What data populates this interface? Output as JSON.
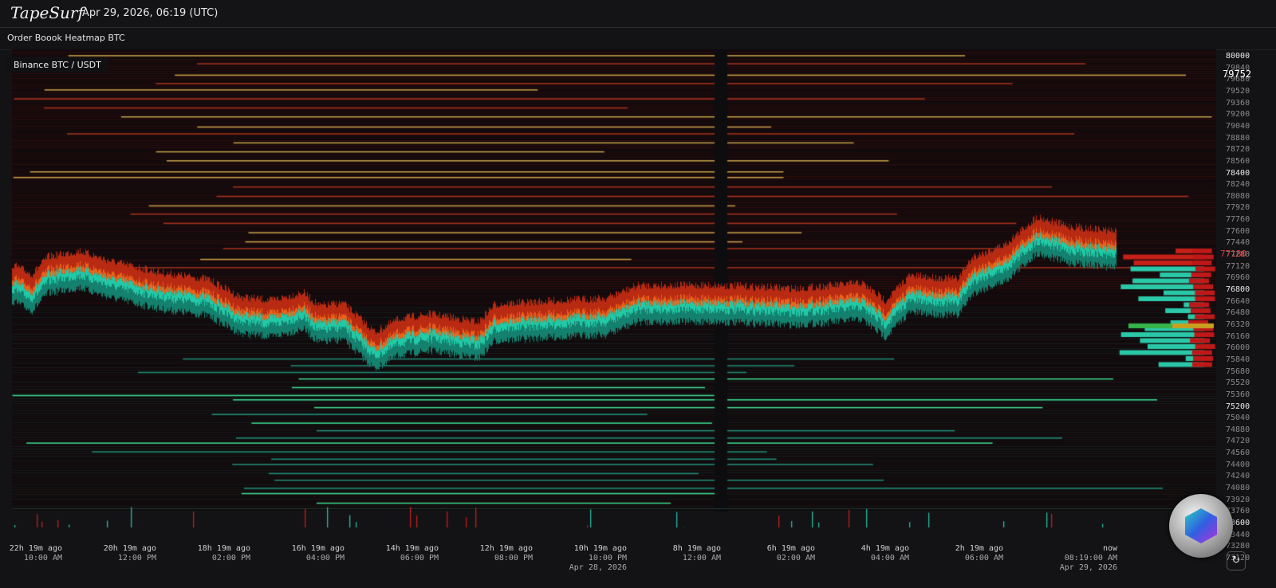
{
  "header": {
    "logo": "TapeSurf",
    "datetime": "Apr 29, 2026, 06:19 (UTC)"
  },
  "panel": {
    "title": "Order Boook Heatmap BTC",
    "pair": "Binance BTC / USDT"
  },
  "price_axis": {
    "labels": [
      "80000",
      "79840",
      "79680",
      "79520",
      "79360",
      "79200",
      "79040",
      "78880",
      "78720",
      "78560",
      "78400",
      "78240",
      "78080",
      "77920",
      "77760",
      "77600",
      "77440",
      "77280",
      "77120",
      "76960",
      "76800",
      "76640",
      "76480",
      "76320",
      "76160",
      "76000",
      "75840",
      "75680",
      "75520",
      "75360",
      "75200",
      "75040",
      "74880",
      "74720",
      "74560",
      "74400",
      "74240",
      "74080",
      "73920",
      "73760",
      "73600",
      "73440",
      "73280",
      "73120"
    ],
    "bold_labels": [
      "80000",
      "78400",
      "76800",
      "75200",
      "73600"
    ],
    "crosshair_price": "79752",
    "last_price": "77180"
  },
  "time_axis": [
    {
      "ago": "22h 19m ago",
      "time": "10:00 AM",
      "date": ""
    },
    {
      "ago": "20h 19m ago",
      "time": "12:00 PM",
      "date": ""
    },
    {
      "ago": "18h 19m ago",
      "time": "02:00 PM",
      "date": ""
    },
    {
      "ago": "16h 19m ago",
      "time": "04:00 PM",
      "date": ""
    },
    {
      "ago": "14h 19m ago",
      "time": "06:00 PM",
      "date": ""
    },
    {
      "ago": "12h 19m ago",
      "time": "08:00 PM",
      "date": ""
    },
    {
      "ago": "10h 19m ago",
      "time": "10:00 PM",
      "date": "Apr 28, 2026"
    },
    {
      "ago": "8h 19m ago",
      "time": "12:00 AM",
      "date": ""
    },
    {
      "ago": "6h 19m ago",
      "time": "02:00 AM",
      "date": ""
    },
    {
      "ago": "4h 19m ago",
      "time": "04:00 AM",
      "date": ""
    },
    {
      "ago": "2h 19m ago",
      "time": "06:00 AM",
      "date": ""
    },
    {
      "ago": "now",
      "time": "08:19:00 AM",
      "date": "Apr 29, 2026"
    }
  ],
  "colors": {
    "bid": "#1fc7a8",
    "ask": "#d12a1a",
    "wall": "#d9a84a",
    "background": "#131316"
  },
  "icons": {
    "refresh": "refresh-icon",
    "coin": "coin-logo"
  }
}
